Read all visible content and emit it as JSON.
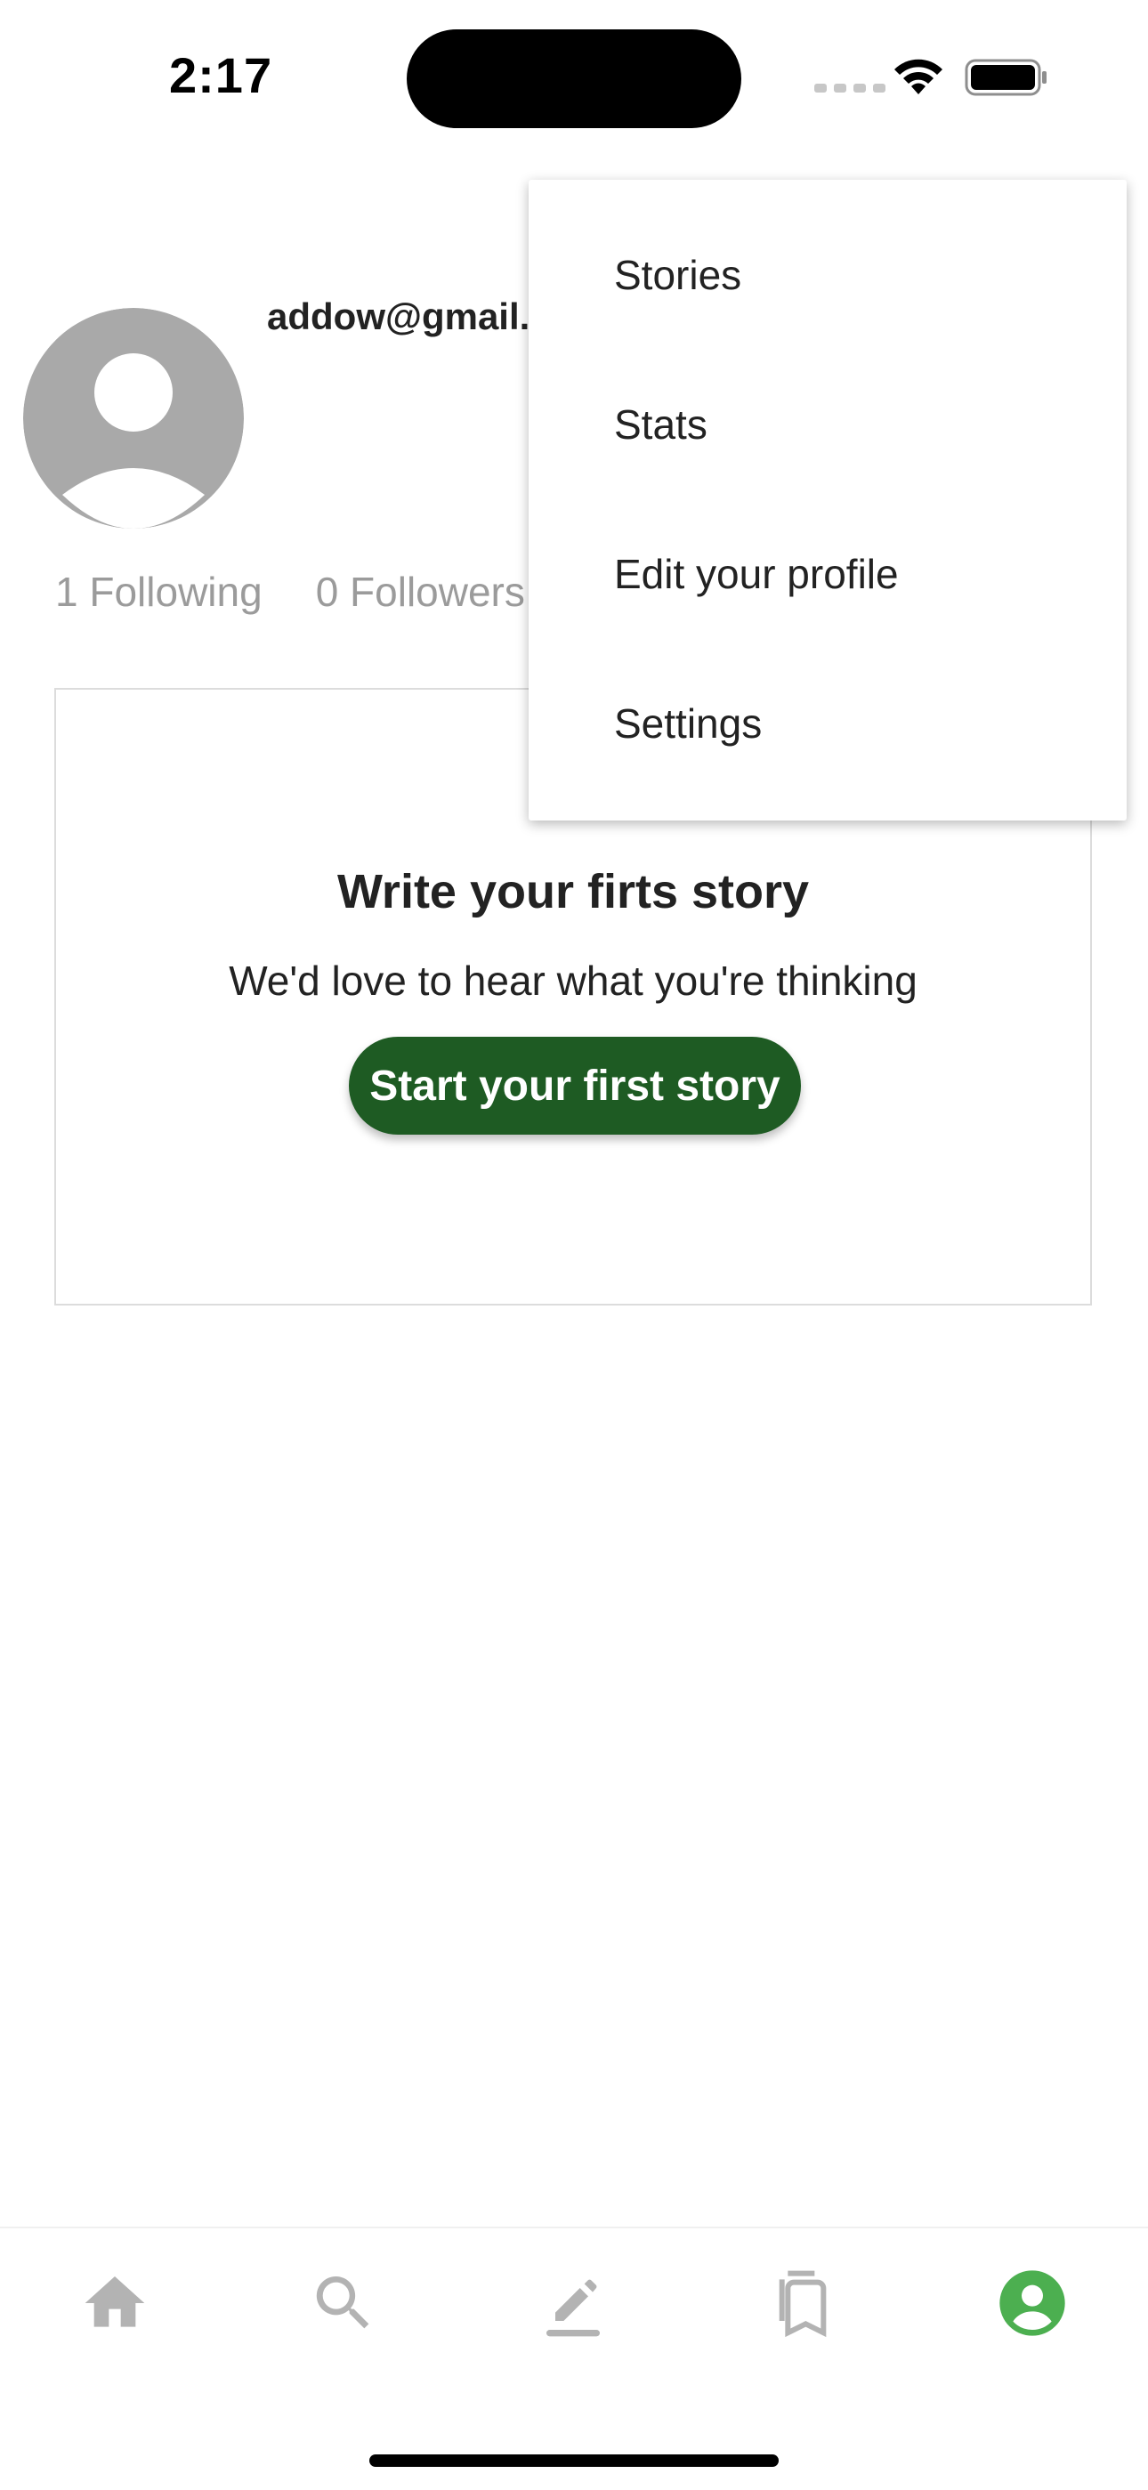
{
  "status_bar": {
    "time": "2:17",
    "icons": [
      "cellular-signal-icon",
      "wifi-icon",
      "battery-icon"
    ]
  },
  "profile": {
    "email": "addow@gmail.co",
    "following": "1 Following",
    "followers": "0 Followers",
    "avatar_icon": "person-placeholder-icon"
  },
  "story_card": {
    "title": "Write your firts story",
    "subtitle": "We'd love to hear what you're thinking",
    "button_label": "Start your first story"
  },
  "menu": {
    "items": [
      {
        "label": "Stories"
      },
      {
        "label": "Stats"
      },
      {
        "label": "Edit your profile"
      },
      {
        "label": "Settings"
      }
    ]
  },
  "bottom_nav": {
    "items": [
      {
        "icon": "home-icon"
      },
      {
        "icon": "search-icon"
      },
      {
        "icon": "pencil-icon"
      },
      {
        "icon": "bookmarks-icon"
      },
      {
        "icon": "profile-icon",
        "active": true
      }
    ],
    "active_color": "#4caf50",
    "inactive_color": "#b3b3b3"
  },
  "colors": {
    "primary_button": "#1e5b23",
    "muted_text": "#9b9b9b",
    "avatar_gray": "#a9a9a9"
  }
}
